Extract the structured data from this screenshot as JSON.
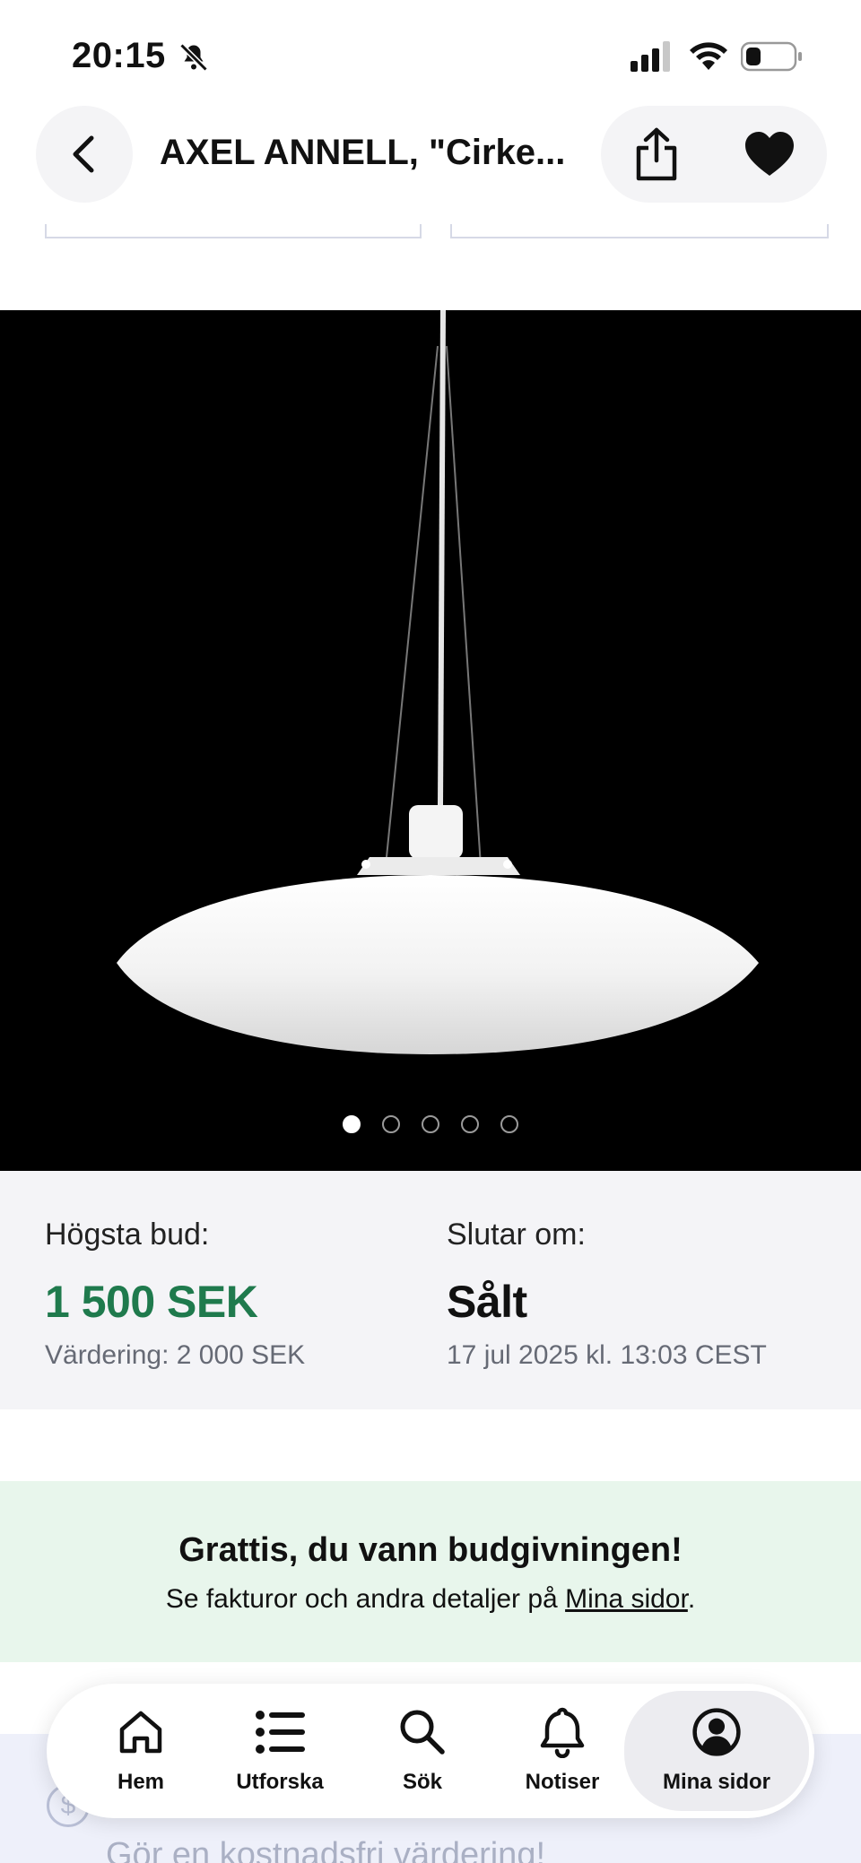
{
  "status_bar": {
    "time": "20:15"
  },
  "header": {
    "title": "AXEL ANNELL, \"Cirke..."
  },
  "auction": {
    "highest_bid_label": "Högsta bud:",
    "highest_bid_value": "1 500 SEK",
    "valuation": "Värdering: 2 000 SEK",
    "ends_label": "Slutar om:",
    "ends_value": "Sålt",
    "end_date": "17 jul 2025 kl. 13:03 CEST"
  },
  "gallery": {
    "image_count": 5,
    "active_index": 0
  },
  "congrats": {
    "title": "Grattis, du vann budgivningen!",
    "text_prefix": "Se fakturor och andra detaljer på ",
    "link": "Mina sidor",
    "text_suffix": "."
  },
  "lower": {
    "partial_text": "Gör en kostnadsfri värdering!"
  },
  "tabbar": {
    "items": [
      {
        "label": "Hem",
        "icon": "home-icon"
      },
      {
        "label": "Utforska",
        "icon": "list-icon"
      },
      {
        "label": "Sök",
        "icon": "search-icon"
      },
      {
        "label": "Notiser",
        "icon": "bell-icon"
      },
      {
        "label": "Mina sidor",
        "icon": "profile-icon"
      }
    ],
    "active": "Mina sidor"
  },
  "colors": {
    "bid_green": "#1f7a4d",
    "congrats_bg": "#e8f6ec",
    "panel_bg": "#f4f4f7"
  }
}
